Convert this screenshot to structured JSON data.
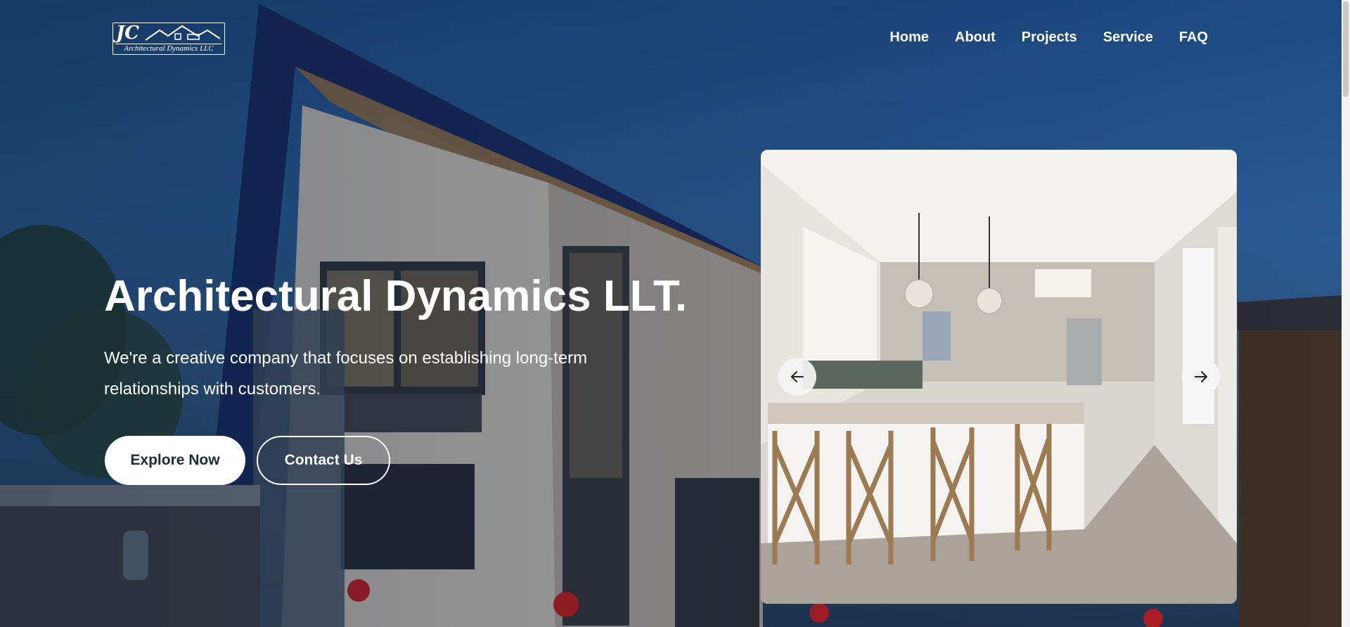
{
  "header": {
    "logo": {
      "mark": "JC",
      "subtitle": "Architectural Dynamics LLC",
      "icon": "house-roofline-icon"
    },
    "nav": [
      {
        "label": "Home"
      },
      {
        "label": "About"
      },
      {
        "label": "Projects"
      },
      {
        "label": "Service"
      },
      {
        "label": "FAQ"
      }
    ]
  },
  "hero": {
    "title": "Architectural Dynamics LLT.",
    "tagline": "We're a creative company that focuses on establishing long-term relationships with customers.",
    "buttons": {
      "primary": "Explore Now",
      "secondary": "Contact Us"
    },
    "background_image": "modern house exterior at dusk",
    "slide_image": "kitchen interior with island and bar stools",
    "arrows": {
      "prev": "arrow-left-icon",
      "next": "arrow-right-icon"
    }
  },
  "colors": {
    "nav_text": "#ffffff",
    "button_primary_bg": "#ffffff",
    "button_primary_text": "#1d2b3d",
    "sky": "#1c4b83"
  }
}
